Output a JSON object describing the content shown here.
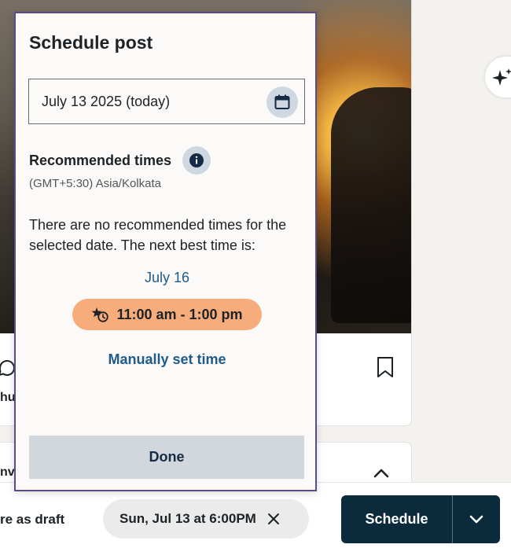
{
  "background": {
    "author_partial": "hu",
    "card2_partial": "nvi",
    "draft_label": "re as draft"
  },
  "popover": {
    "title": "Schedule post",
    "date_value": "July 13 2025 (today)",
    "recommended_title": "Recommended times",
    "timezone": "(GMT+5:30) Asia/Kolkata",
    "no_rec_message": "There are no recommended times for the selected date. The next best time is:",
    "next_date": "July 16",
    "time_slot": "11:00 am - 1:00 pm",
    "manual_link": "Manually set time",
    "done_label": "Done"
  },
  "bottom_bar": {
    "scheduled_chip": "Sun, Jul 13 at 6:00PM",
    "schedule_label": "Schedule"
  },
  "icons": {
    "calendar": "calendar-icon",
    "info": "info-icon",
    "star_clock": "star-clock-icon",
    "close": "close-icon",
    "chevron_down": "chevron-down-icon",
    "chevron_up": "chevron-up-icon",
    "bookmark": "bookmark-icon",
    "comment": "comment-icon",
    "sparkle": "sparkle-icon"
  },
  "colors": {
    "popover_border": "#5a4b8a",
    "accent_link": "#1e5b8a",
    "time_pill": "#f6ad7b",
    "schedule_button": "#0b2b3c",
    "done_button": "#d2d7de"
  }
}
